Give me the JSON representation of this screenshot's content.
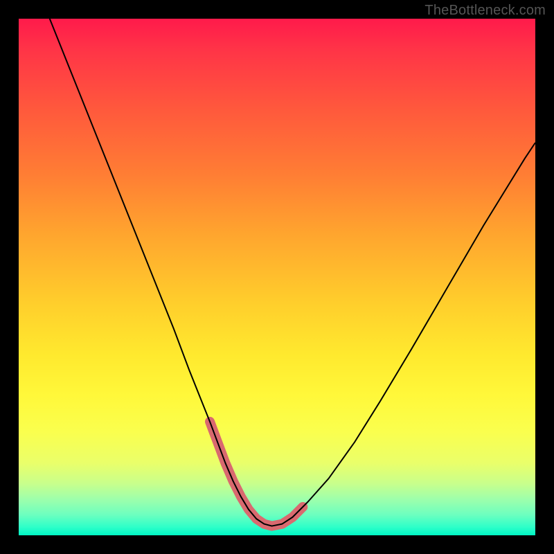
{
  "watermark": "TheBottleneck.com",
  "chart_data": {
    "type": "line",
    "title": "",
    "xlabel": "",
    "ylabel": "",
    "xlim": [
      0,
      100
    ],
    "ylim": [
      0,
      100
    ],
    "series": [
      {
        "name": "black-curve",
        "x": [
          6,
          10,
          14,
          18,
          22,
          26,
          30,
          33,
          35,
          37,
          38.5,
          40,
          41.5,
          43,
          44.5,
          46,
          47.5,
          49,
          51,
          53,
          56,
          60,
          65,
          70,
          76,
          83,
          90,
          98,
          100
        ],
        "y": [
          100,
          90,
          80,
          70,
          60,
          50,
          40,
          32,
          27,
          22,
          18,
          14,
          10.5,
          7.5,
          5,
          3.2,
          2.2,
          1.8,
          2.2,
          3.5,
          6.5,
          11,
          18,
          26,
          36,
          48,
          60,
          73,
          76
        ],
        "stroke": "#000000",
        "width": 2
      },
      {
        "name": "pink-highlight",
        "x": [
          37,
          38.5,
          40,
          41.5,
          43,
          44.5,
          46,
          47.5,
          49,
          51,
          53,
          55
        ],
        "y": [
          22,
          18,
          14,
          10.5,
          7.5,
          5,
          3.2,
          2.2,
          1.8,
          2.2,
          3.5,
          5.5
        ],
        "stroke": "#d9696f",
        "width": 14,
        "linecap": "round"
      }
    ],
    "gradient_stops": [
      {
        "pct": 0,
        "color": "#ff1a4b"
      },
      {
        "pct": 18,
        "color": "#ff5a3c"
      },
      {
        "pct": 42,
        "color": "#ffa62e"
      },
      {
        "pct": 65,
        "color": "#ffe92e"
      },
      {
        "pct": 86,
        "color": "#eaff6a"
      },
      {
        "pct": 100,
        "color": "#00f5c4"
      }
    ]
  }
}
